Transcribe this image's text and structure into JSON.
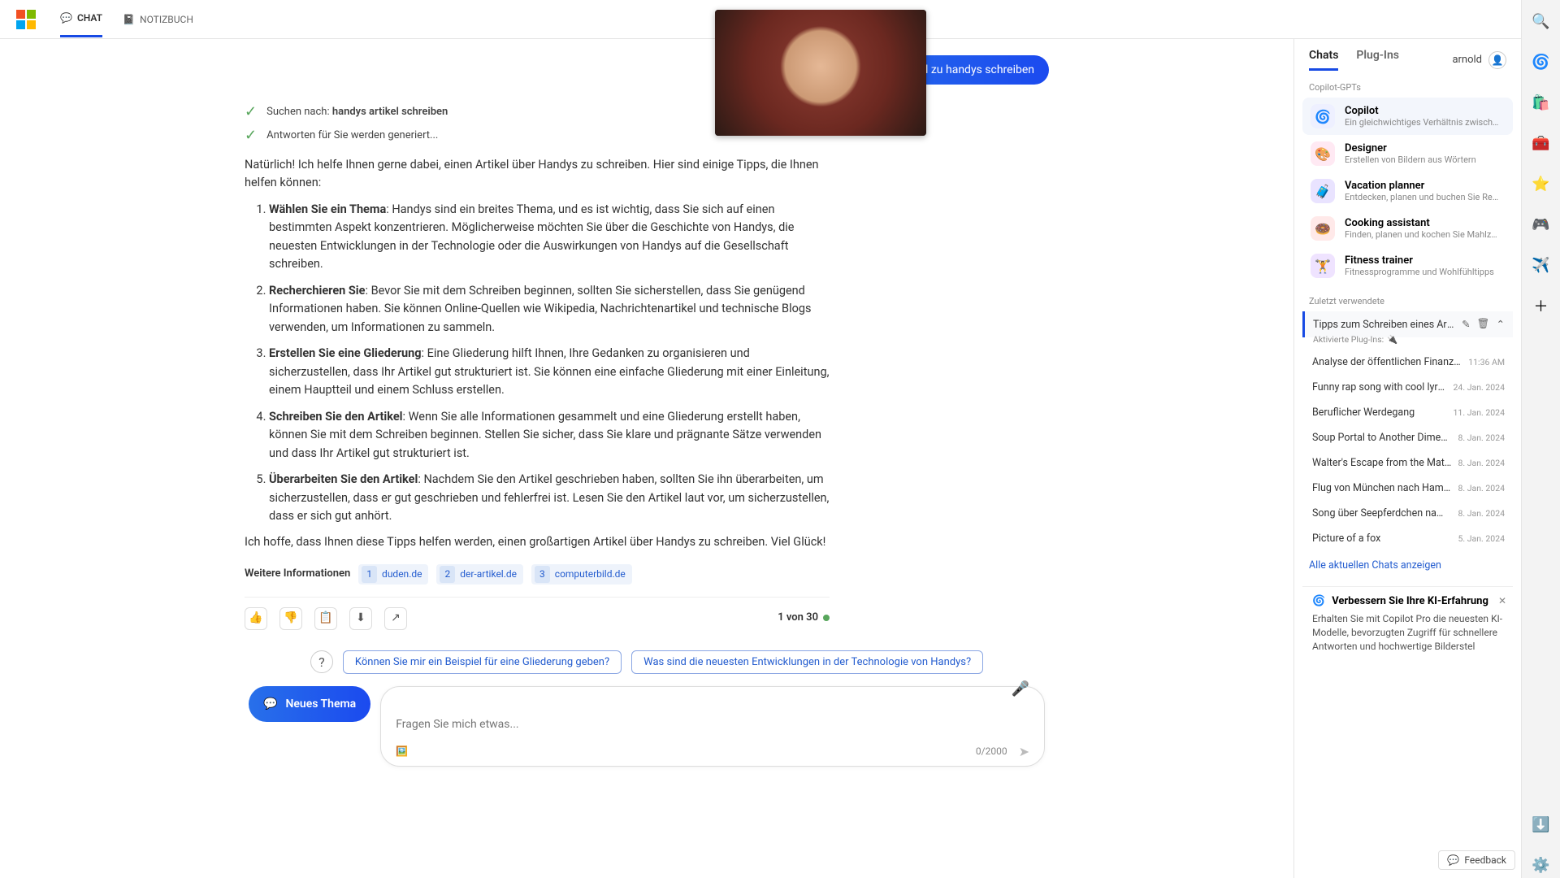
{
  "header": {
    "tab_chat": "CHAT",
    "tab_notebook": "NOTIZBUCH"
  },
  "chat": {
    "user_message": "ich willeinen artikel zu handys schreiben",
    "status_searching_prefix": "Suchen nach: ",
    "status_searching_query": "handys artikel schreiben",
    "status_generating": "Antworten für Sie werden generiert...",
    "response_intro": "Natürlich! Ich helfe Ihnen gerne dabei, einen Artikel über Handys zu schreiben. Hier sind einige Tipps, die Ihnen helfen können:",
    "tips": [
      {
        "title": "Wählen Sie ein Thema",
        "body": ": Handys sind ein breites Thema, und es ist wichtig, dass Sie sich auf einen bestimmten Aspekt konzentrieren. Möglicherweise möchten Sie über die Geschichte von Handys, die neuesten Entwicklungen in der Technologie oder die Auswirkungen von Handys auf die Gesellschaft schreiben."
      },
      {
        "title": "Recherchieren Sie",
        "body": ": Bevor Sie mit dem Schreiben beginnen, sollten Sie sicherstellen, dass Sie genügend Informationen haben. Sie können Online-Quellen wie Wikipedia, Nachrichtenartikel und technische Blogs verwenden, um Informationen zu sammeln."
      },
      {
        "title": "Erstellen Sie eine Gliederung",
        "body": ": Eine Gliederung hilft Ihnen, Ihre Gedanken zu organisieren und sicherzustellen, dass Ihr Artikel gut strukturiert ist. Sie können eine einfache Gliederung mit einer Einleitung, einem Hauptteil und einem Schluss erstellen."
      },
      {
        "title": "Schreiben Sie den Artikel",
        "body": ": Wenn Sie alle Informationen gesammelt und eine Gliederung erstellt haben, können Sie mit dem Schreiben beginnen. Stellen Sie sicher, dass Sie klare und prägnante Sätze verwenden und dass Ihr Artikel gut strukturiert ist."
      },
      {
        "title": "Überarbeiten Sie den Artikel",
        "body": ": Nachdem Sie den Artikel geschrieben haben, sollten Sie ihn überarbeiten, um sicherzustellen, dass er gut geschrieben und fehlerfrei ist. Lesen Sie den Artikel laut vor, um sicherzustellen, dass er sich gut anhört."
      }
    ],
    "response_outro": "Ich hoffe, dass Ihnen diese Tipps helfen werden, einen großartigen Artikel über Handys zu schreiben. Viel Glück!",
    "more_label": "Weitere Informationen",
    "sources": [
      {
        "n": "1",
        "domain": "duden.de"
      },
      {
        "n": "2",
        "domain": "der-artikel.de"
      },
      {
        "n": "3",
        "domain": "computerbild.de"
      }
    ],
    "counter": "1 von 30",
    "suggestions": [
      "Können Sie mir ein Beispiel für eine Gliederung geben?",
      "Was sind die neuesten Entwicklungen in der Technologie von Handys?"
    ],
    "new_topic": "Neues Thema",
    "input_placeholder": "Fragen Sie mich etwas...",
    "char_count": "0/2000"
  },
  "sidebar": {
    "tab_chats": "Chats",
    "tab_plugins": "Plug-Ins",
    "username": "arnold",
    "section_gpts": "Copilot-GPTs",
    "gpts": [
      {
        "name": "Copilot",
        "desc": "Ein gleichwichtiges Verhältnis zwischen KI u",
        "icon": "🌀",
        "bg": "#eef0ff"
      },
      {
        "name": "Designer",
        "desc": "Erstellen von Bildern aus Wörtern",
        "icon": "🎨",
        "bg": "#ffe9f3"
      },
      {
        "name": "Vacation planner",
        "desc": "Entdecken, planen und buchen Sie Reisen",
        "icon": "🧳",
        "bg": "#e9e3ff"
      },
      {
        "name": "Cooking assistant",
        "desc": "Finden, planen und kochen Sie Mahlzeiten",
        "icon": "🍩",
        "bg": "#ffe9e9"
      },
      {
        "name": "Fitness trainer",
        "desc": "Fitnessprogramme und Wohlfühltipps",
        "icon": "🏋️",
        "bg": "#efe3ff"
      }
    ],
    "section_recent": "Zuletzt verwendete",
    "recents": [
      {
        "title": "Tipps zum Schreiben eines Artikels",
        "date": "",
        "active": true,
        "plugins": "Aktivierte Plug-Ins:"
      },
      {
        "title": "Analyse der öffentlichen Finanzierung de",
        "date": "11:36 AM"
      },
      {
        "title": "Funny rap song with cool lyrics",
        "date": "24. Jan. 2024"
      },
      {
        "title": "Beruflicher Werdegang",
        "date": "11. Jan. 2024"
      },
      {
        "title": "Soup Portal to Another Dimension",
        "date": "8. Jan. 2024"
      },
      {
        "title": "Walter's Escape from the Matrix",
        "date": "8. Jan. 2024"
      },
      {
        "title": "Flug von München nach Hamburg",
        "date": "8. Jan. 2024"
      },
      {
        "title": "Song über Seepferdchen namens Bubl",
        "date": "8. Jan. 2024"
      },
      {
        "title": "Picture of a fox",
        "date": "5. Jan. 2024"
      }
    ],
    "show_all": "Alle aktuellen Chats anzeigen",
    "promo_title": "Verbessern Sie Ihre KI-Erfahrung",
    "promo_text": "Erhalten Sie mit Copilot Pro die neuesten KI-Modelle, bevorzugten Zugriff für schnellere Antworten und hochwertige Bilderstel"
  },
  "feedback": "Feedback"
}
